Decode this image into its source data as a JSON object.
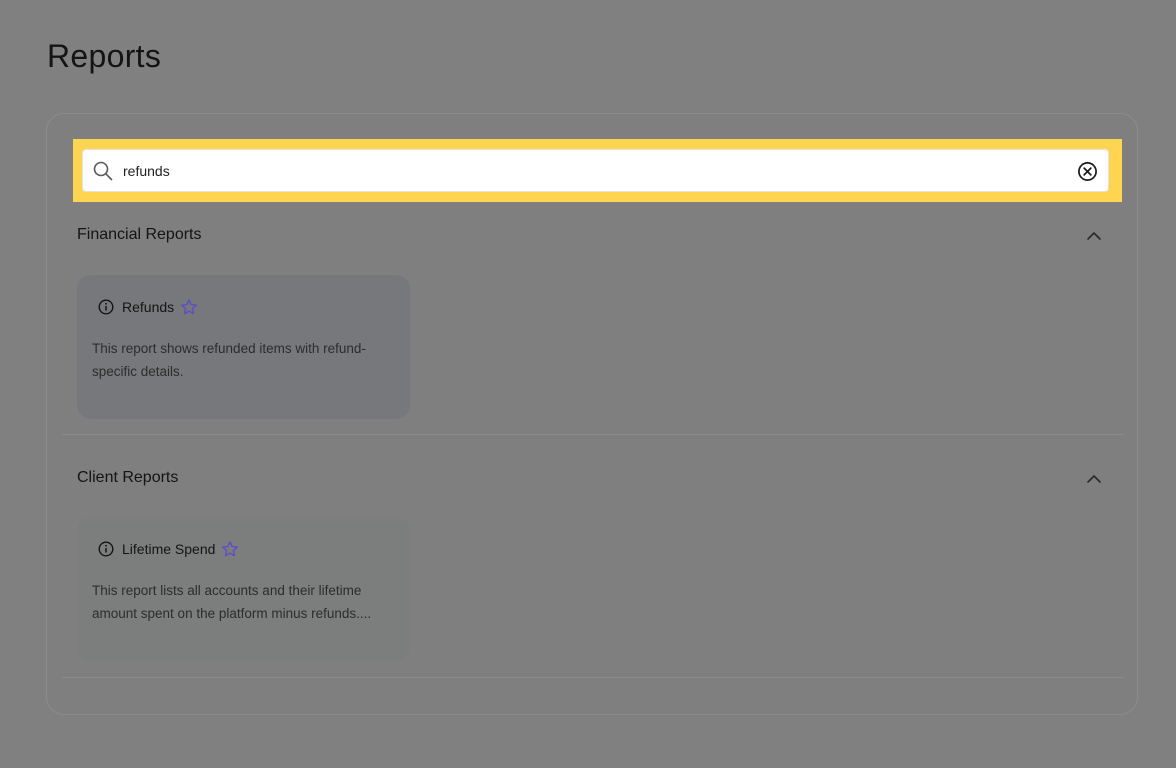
{
  "page": {
    "title": "Reports"
  },
  "search": {
    "value": "refunds"
  },
  "sections": [
    {
      "title": "Financial Reports",
      "cards": [
        {
          "title": "Refunds",
          "description": "This report shows refunded items with refund-specific details."
        }
      ]
    },
    {
      "title": "Client Reports",
      "cards": [
        {
          "title": "Lifetime Spend",
          "description": "This report lists all accounts and their lifetime amount spent on the platform minus refunds...."
        }
      ]
    }
  ],
  "colors": {
    "highlight": "#ffd451",
    "star": "#5a4fc4",
    "overlay": "#808080"
  },
  "icons": [
    "search-icon",
    "clear-search-icon",
    "chevron-up-icon",
    "info-icon",
    "star-icon"
  ]
}
